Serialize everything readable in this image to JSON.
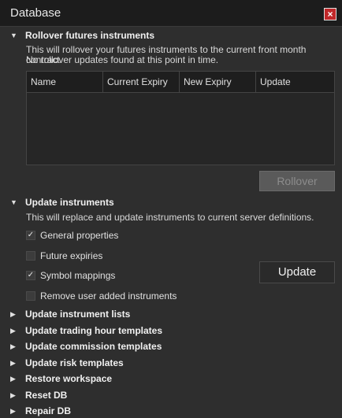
{
  "window": {
    "title": "Database",
    "close_label": "×"
  },
  "rollover": {
    "title": "Rollover futures instruments",
    "desc_line1": "This will rollover your futures instruments to the current front month contract.",
    "desc_line2": "No rollover updates found at this point in time.",
    "columns": [
      "Name",
      "Current Expiry",
      "New Expiry",
      "Update"
    ],
    "button_label": "Rollover"
  },
  "update": {
    "title": "Update instruments",
    "desc": "This will replace and update instruments to current server definitions.",
    "options": [
      {
        "label": "General properties",
        "checked": true
      },
      {
        "label": "Future expiries",
        "checked": false
      },
      {
        "label": "Symbol mappings",
        "checked": true
      },
      {
        "label": "Remove user added instruments",
        "checked": false
      }
    ],
    "button_label": "Update"
  },
  "collapsed_sections": [
    "Update instrument lists",
    "Update trading hour templates",
    "Update commission templates",
    "Update risk templates",
    "Restore workspace",
    "Reset DB",
    "Repair DB"
  ],
  "icons": {
    "expanded": "triangle-down-icon",
    "collapsed": "triangle-right-icon"
  }
}
